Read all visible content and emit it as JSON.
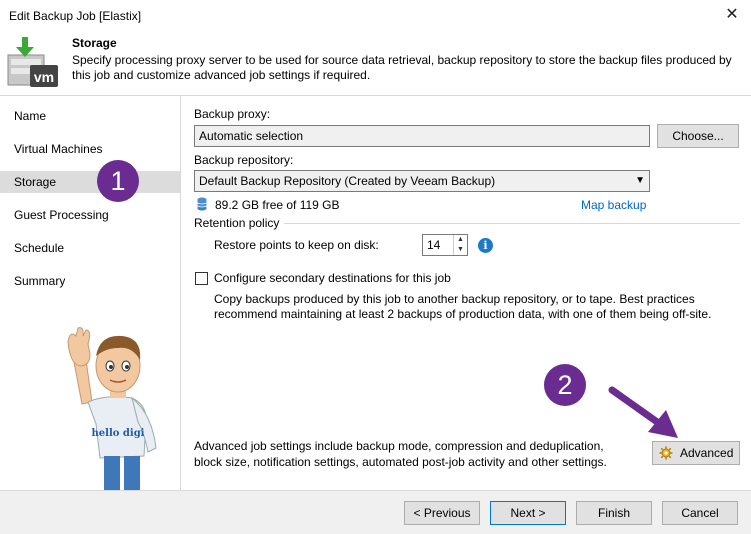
{
  "window": {
    "title": "Edit Backup Job [Elastix]",
    "close_glyph": "✕"
  },
  "header": {
    "title": "Storage",
    "description": "Specify processing proxy server to be used for source data retrieval, backup repository to store the backup files produced by this job and customize advanced job settings if required.",
    "logo_text": "vm"
  },
  "sidebar": {
    "items": [
      {
        "label": "Name"
      },
      {
        "label": "Virtual Machines"
      },
      {
        "label": "Storage"
      },
      {
        "label": "Guest Processing"
      },
      {
        "label": "Schedule"
      },
      {
        "label": "Summary"
      }
    ],
    "mascot_shirt_text": "hello digi"
  },
  "annotations": {
    "badge1": "1",
    "badge2": "2"
  },
  "form": {
    "proxy_label": "Backup proxy:",
    "proxy_value": "Automatic selection",
    "choose_label": "Choose...",
    "repo_label": "Backup repository:",
    "repo_value": "Default Backup Repository (Created by Veeam Backup)",
    "repo_space": "89.2 GB free of 119 GB",
    "map_backup": "Map backup",
    "retention_label": "Retention policy",
    "restore_label": "Restore points to keep on disk:",
    "restore_value": "14",
    "secondary_label": "Configure secondary destinations for this job",
    "secondary_desc": "Copy backups produced by this job to another backup repository, or to tape. Best practices recommend maintaining at least 2 backups of production data, with one of them being off-site.",
    "advanced_desc": "Advanced job settings include backup mode, compression and deduplication, block size, notification settings, automated post-job activity and other settings.",
    "advanced_label": "Advanced"
  },
  "footer": {
    "previous": "< Previous",
    "next": "Next >",
    "finish": "Finish",
    "cancel": "Cancel"
  },
  "colors": {
    "badge": "#6a2c91",
    "link": "#0066cc",
    "active_nav": "#dcdcdc",
    "logo_green": "#3aa935"
  }
}
